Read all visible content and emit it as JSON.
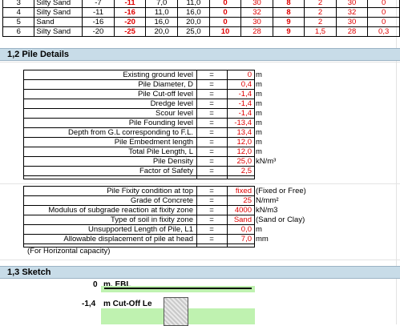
{
  "soil_rows": [
    {
      "no": "3",
      "type": "Silty Sand",
      "a": "-7",
      "b": "-11",
      "c": "7,0",
      "d": "11,0",
      "e": "0",
      "f": "30",
      "g": "8",
      "h": "2",
      "i": "30",
      "j": "0"
    },
    {
      "no": "4",
      "type": "Silty Sand",
      "a": "-11",
      "b": "-16",
      "c": "11,0",
      "d": "16,0",
      "e": "0",
      "f": "32",
      "g": "8",
      "h": "2",
      "i": "32",
      "j": "0"
    },
    {
      "no": "5",
      "type": "Sand",
      "a": "-16",
      "b": "-20",
      "c": "16,0",
      "d": "20,0",
      "e": "0",
      "f": "30",
      "g": "9",
      "h": "2",
      "i": "30",
      "j": "0"
    },
    {
      "no": "6",
      "type": "Silty Sand",
      "a": "-20",
      "b": "-25",
      "c": "20,0",
      "d": "25,0",
      "e": "10",
      "f": "28",
      "g": "9",
      "h": "1,5",
      "i": "28",
      "j": "0,3"
    }
  ],
  "section_pile": "1,2  Pile Details",
  "pile_details": [
    {
      "label": "Existing ground level",
      "eq": "=",
      "value": "0",
      "unit": "m"
    },
    {
      "label": "Pile Diameter, D",
      "eq": "=",
      "value": "0,4",
      "unit": "m"
    },
    {
      "label": "Pile Cut-off level",
      "eq": "=",
      "value": "-1,4",
      "unit": "m"
    },
    {
      "label": "Dredge level",
      "eq": "=",
      "value": "-1,4",
      "unit": "m"
    },
    {
      "label": "Scour level",
      "eq": "=",
      "value": "-1,4",
      "unit": "m"
    },
    {
      "label": "Pile Founding level",
      "eq": "=",
      "value": "-13,4",
      "unit": "m"
    },
    {
      "label": "Depth from G.L corresponding to F.L.",
      "eq": "=",
      "value": "13,4",
      "unit": "m"
    },
    {
      "label": "Pile Embedment length",
      "eq": "=",
      "value": "12,0",
      "unit": "m"
    },
    {
      "label": "Total Pile Length, L",
      "eq": "=",
      "value": "12,0",
      "unit": "m"
    },
    {
      "label": "Pile Density",
      "eq": "=",
      "value": "25,0",
      "unit": "kN/m³"
    },
    {
      "label": "Factor of Safety",
      "eq": "=",
      "value": "2,5",
      "unit": ""
    }
  ],
  "fixity": [
    {
      "label": "Pile Fixity condition at top",
      "eq": "=",
      "value": "fixed",
      "unit": "(Fixed or Free)"
    },
    {
      "label": "Grade of Concrete",
      "eq": "=",
      "value": "25",
      "unit": "N/mm²"
    },
    {
      "label": "Modulus of subgrade reaction at fixity zone",
      "eq": "=",
      "value": "4000",
      "unit": "kN/m3"
    },
    {
      "label": "Type of soil in fixity zone",
      "eq": "=",
      "value": "Sand",
      "unit": "(Sand or Clay)"
    },
    {
      "label": "Unsupported Length of Pile, L1",
      "eq": "=",
      "value": "0,0",
      "unit": "m"
    },
    {
      "label": "Allowable displacement of pile at head",
      "eq": "=",
      "value": "7,0",
      "unit": "mm"
    }
  ],
  "horizontal_note": "(For Horizontal capacity)",
  "section_sketch": "1,3  Sketch",
  "sketch": {
    "ebl_value": "0",
    "ebl_label": "m, EBL",
    "cutoff_value": "-1,4",
    "cutoff_label": "m Cut-Off  Le"
  },
  "colors": {
    "value_red": "#e00000",
    "section_blue": "#c8dce8",
    "sketch_green": "#bff2b0"
  }
}
